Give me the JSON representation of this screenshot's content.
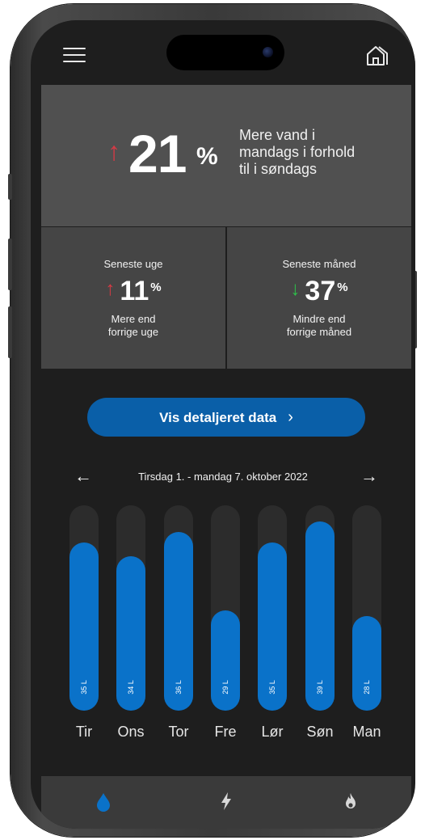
{
  "header": {
    "menu_icon": "hamburger-menu-icon",
    "home_icon": "home-icon"
  },
  "summary": {
    "arrow": "↑",
    "value": "21",
    "unit": "%",
    "description_lines": [
      "Mere vand i",
      "mandags i forhold",
      "til i søndags"
    ],
    "arrow_color": "#d63a45"
  },
  "week": {
    "label": "Seneste uge",
    "arrow": "↑",
    "value": "11",
    "unit": "%",
    "description_lines": [
      "Mere end",
      "forrige uge"
    ],
    "arrow_color": "#d63a45"
  },
  "month": {
    "label": "Seneste måned",
    "arrow": "↓",
    "value": "37",
    "unit": "%",
    "description_lines": [
      "Mindre end",
      "forrige måned"
    ],
    "arrow_color": "#2ec24a"
  },
  "detail_button": {
    "label": "Vis detaljeret data",
    "chevron": "›"
  },
  "range": {
    "prev": "←",
    "label": "Tirsdag 1. - mandag 7. oktober 2022",
    "next": "→"
  },
  "chart_data": {
    "type": "bar",
    "categories": [
      "Tir",
      "Ons",
      "Tor",
      "Fre",
      "Lør",
      "Søn",
      "Man"
    ],
    "values": [
      35,
      34,
      36,
      29,
      35,
      39,
      28
    ],
    "value_labels": [
      "35 L",
      "34 L",
      "36 L",
      "29 L",
      "35 L",
      "39 L",
      "28 L"
    ],
    "fill_fraction": [
      0.82,
      0.75,
      0.87,
      0.49,
      0.82,
      0.92,
      0.46
    ],
    "bar_color": "#0a72c9",
    "track_color": "#2c2c2c"
  },
  "tabs": [
    {
      "name": "water-drop-icon",
      "active": true,
      "color": "#0a72c9"
    },
    {
      "name": "lightning-icon",
      "active": false,
      "color": "#d8d8d8"
    },
    {
      "name": "flame-icon",
      "active": false,
      "color": "#d8d8d8"
    }
  ],
  "colors": {
    "accent": "#0a5fa8",
    "background": "#1e1e1e",
    "summary_panel": "#505050",
    "mini_panel": "#454545"
  }
}
